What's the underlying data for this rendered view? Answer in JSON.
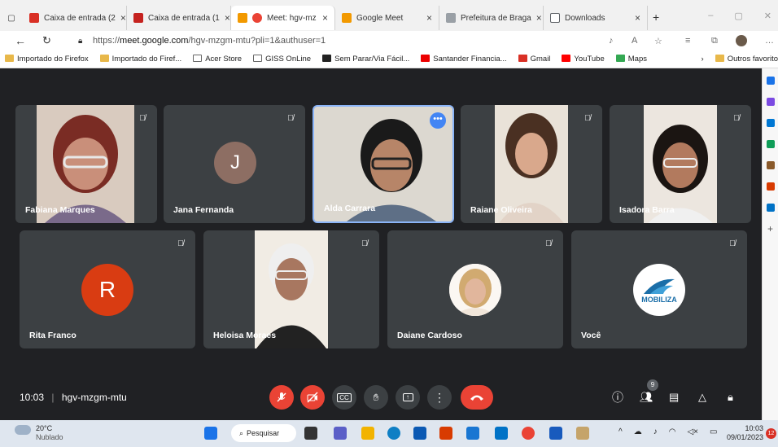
{
  "browser": {
    "tabs": [
      {
        "label": "Caixa de entrada (2",
        "color": "#d93025"
      },
      {
        "label": "Caixa de entrada (1",
        "color": "#c5221f"
      },
      {
        "label": "Meet: hgv-mz",
        "color": "#f29900"
      },
      {
        "label": "Google Meet",
        "color": "#f29900"
      },
      {
        "label": "Prefeitura de Braga",
        "color": "#9aa0a6"
      },
      {
        "label": "Downloads",
        "color": "#5f6368"
      }
    ],
    "url_prefix": "https://",
    "url_host": "meet.google.com",
    "url_path": "/hgv-mzgm-mtu?pli=1&authuser=1",
    "bookmarks": [
      "Importado do Firefox",
      "Importado do Firef...",
      "Acer Store",
      "GISS OnLine",
      "Sem Parar/Via Fácil...",
      "Santander Financia...",
      "Gmail",
      "YouTube",
      "Maps"
    ],
    "other_favorites": "Outros favorito"
  },
  "meet": {
    "participants": [
      {
        "name": "Fabiana Marques",
        "type": "video",
        "bg": "#d9cbbf",
        "skin": "#c98f7a",
        "hair": "#7a2c24"
      },
      {
        "name": "Jana Fernanda",
        "type": "avatar",
        "initial": "J",
        "color": "#8d6e63"
      },
      {
        "name": "Alda Carrara",
        "type": "video",
        "bg": "#d8d4cc",
        "skin": "#b78568",
        "hair": "#1a1a1a"
      },
      {
        "name": "Raiane Oliveira",
        "type": "video",
        "bg": "#e9e2d8",
        "skin": "#d9a88c",
        "hair": "#4a3022"
      },
      {
        "name": "Isadora Barra",
        "type": "video",
        "bg": "#ece6df",
        "skin": "#b27a5e",
        "hair": "#1b1512"
      },
      {
        "name": "Rita Franco",
        "type": "avatar",
        "initial": "R",
        "color": "#d93c12"
      },
      {
        "name": "Heloisa Moraes",
        "type": "video",
        "bg": "#f1ece4",
        "skin": "#a87760",
        "hair": "#efefef"
      },
      {
        "name": "Daiane Cardoso",
        "type": "photo",
        "skin": "#e1b69c",
        "hair": "#d1aa70"
      },
      {
        "name": "Você",
        "type": "logo",
        "logo_text": "MOBILIZA"
      }
    ],
    "time": "10:03",
    "separator": "|",
    "meeting_code": "hgv-mzgm-mtu",
    "people_count": "9"
  },
  "taskbar": {
    "temp": "20°C",
    "weather": "Nublado",
    "search": "Pesquisar",
    "clock_time": "10:03",
    "clock_date": "09/01/2023",
    "notif_count": "12"
  }
}
